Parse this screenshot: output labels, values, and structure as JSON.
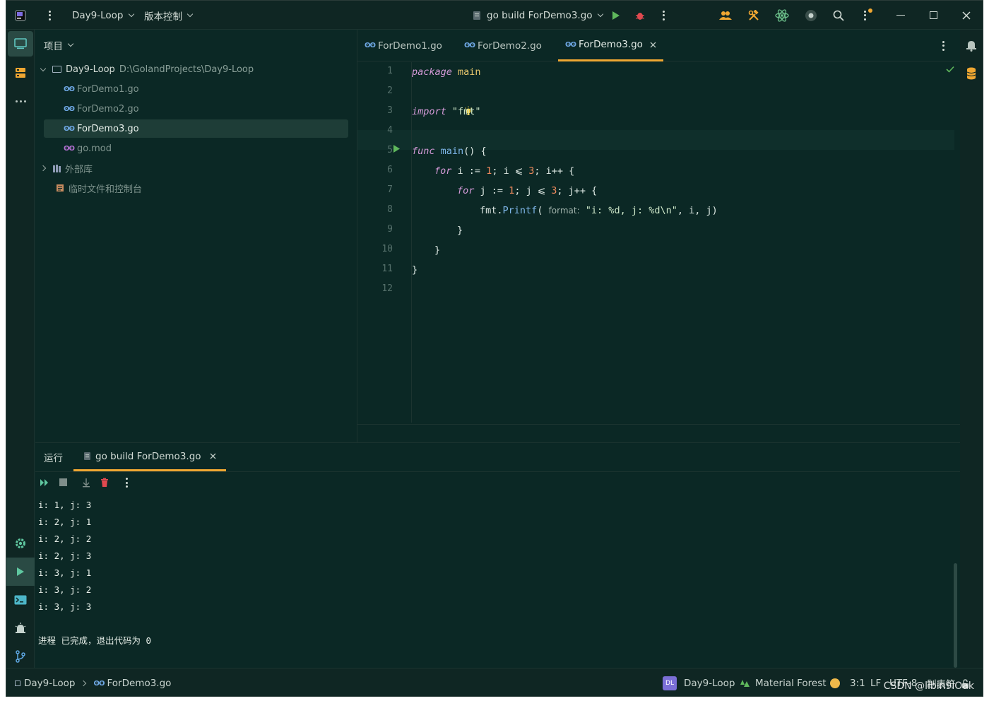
{
  "titlebar": {
    "project": "Day9-Loop",
    "vcs": "版本控制",
    "run_config": "go build ForDemo3.go"
  },
  "project_panel": {
    "header": "项目",
    "root_name": "Day9-Loop",
    "root_path": "D:\\GolandProjects\\Day9-Loop",
    "files": [
      "ForDemo1.go",
      "ForDemo2.go",
      "ForDemo3.go",
      "go.mod"
    ],
    "selected_file": "ForDemo3.go",
    "external_libs": "外部库",
    "scratches": "临时文件和控制台"
  },
  "editor": {
    "tabs": [
      "ForDemo1.go",
      "ForDemo2.go",
      "ForDemo3.go"
    ],
    "active_tab": "ForDemo3.go",
    "line_numbers": [
      "1",
      "2",
      "3",
      "4",
      "5",
      "6",
      "7",
      "8",
      "9",
      "10",
      "11",
      "12"
    ],
    "code": {
      "l1_kw": "package",
      "l1_id": "main",
      "l3_kw": "import",
      "l3_str": "\"fmt\"",
      "l5_kw": "func",
      "l5_fn": "main",
      "l5_rest": "() {",
      "l6_kw": "for",
      "l6_a": " i := ",
      "l6_n1": "1",
      "l6_b": "; i ⩽ ",
      "l6_n2": "3",
      "l6_c": "; i++ {",
      "l7_kw": "for",
      "l7_a": " j := ",
      "l7_n1": "1",
      "l7_b": "; j ⩽ ",
      "l7_n2": "3",
      "l7_c": "; j++ {",
      "l8_pkg": "fmt",
      "l8_fn": "Printf",
      "l8_open": "( ",
      "l8_hint": "format:",
      "l8_str": " \"i: %d, j: %d\\n\"",
      "l8_rest": ", i, j)",
      "l9": "}",
      "l10": "}",
      "l11": "}"
    }
  },
  "run_panel": {
    "tab_run": "运行",
    "tab_build": "go build ForDemo3.go",
    "output": [
      "i: 1, j: 3",
      "i: 2, j: 1",
      "i: 2, j: 2",
      "i: 2, j: 3",
      "i: 3, j: 1",
      "i: 3, j: 2",
      "i: 3, j: 3",
      "",
      "进程 已完成，退出代码为 0"
    ]
  },
  "statusbar": {
    "breadcrumb_project": "Day9-Loop",
    "breadcrumb_file": "ForDemo3.go",
    "badge": "DL",
    "project": "Day9-Loop",
    "theme": "Material Forest",
    "position": "3:1",
    "line_sep": "LF",
    "encoding": "UTF-8",
    "indent": "制表符"
  },
  "watermark": "CSDN @libin9iOak",
  "colors": {
    "background": "#0b2825",
    "accent": "#f0a732",
    "keyword": "#d49ad8",
    "function": "#7fb7ea",
    "number": "#f08a5d"
  }
}
